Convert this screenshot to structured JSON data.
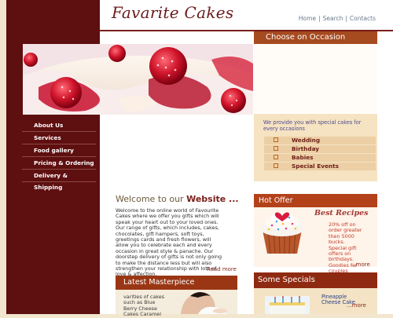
{
  "site": {
    "logo": "Favarite Cakes"
  },
  "top_nav": {
    "items": [
      "Home",
      "Search",
      "Contacts"
    ],
    "separator": "|"
  },
  "side_nav": {
    "items": [
      "About Us",
      "Services",
      "Food gallery",
      "Pricing & Ordering",
      "Delivery & Shipping"
    ]
  },
  "occasion": {
    "title": "Choose on Occasion",
    "intro": "We provide you with special cakes for every occasions",
    "items": [
      "Wedding",
      "Birthday",
      "Babies",
      "Special Events"
    ]
  },
  "welcome": {
    "title_prefix": "Welcome to our",
    "title_highlight": "Website ...",
    "lines": [
      "Welcome to the online world of Favourite",
      "Cakes where we offer you gifts which will",
      "speak your heart out to your loved ones.",
      "Our range of gifts, which includes, cakes,",
      "chocolates, gift hampers, soft toys,",
      "greetings cards and fresh flowers, will",
      "allow you to celebrate each and every",
      "occasion in great style & panache. Our",
      "doorstep delivery of gifts is not only going",
      "to make the distance less but will also",
      "strengthen your relationship with lots of",
      "love & affection."
    ],
    "read_more": "Read more"
  },
  "latest": {
    "title": "Latest Masterpiece",
    "lines": [
      "varities of cakes",
      "such as Blue",
      "Berry Cheese",
      "Cakes Caramel"
    ]
  },
  "hot_offer": {
    "title": "Hot Offer",
    "banner": "Best Recipes",
    "lines": [
      "20% off on",
      "order greater",
      "then 5000",
      "bucks.",
      "Special gift",
      "offers on",
      "birthdays.",
      "Goodies for",
      "couples"
    ],
    "more": "...more"
  },
  "specials": {
    "title": "Some Specials",
    "lines": [
      "Pineapple",
      "Cheese Cake"
    ],
    "more": "...more"
  },
  "colors": {
    "maroon": "#5e0f10",
    "header_brown": "#a64a1f",
    "cream": "#f2e6cf"
  }
}
